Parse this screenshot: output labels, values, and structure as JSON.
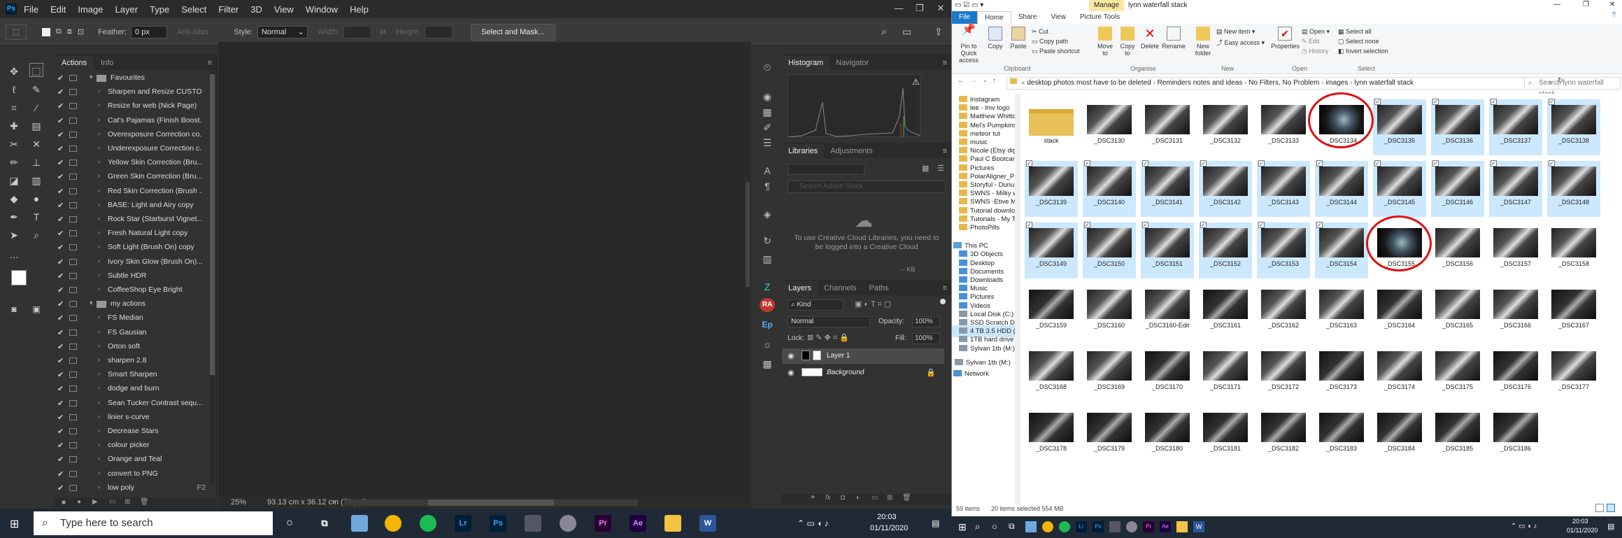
{
  "ps": {
    "logo": "Ps",
    "menu": [
      "File",
      "Edit",
      "Image",
      "Layer",
      "Type",
      "Select",
      "Filter",
      "3D",
      "View",
      "Window",
      "Help"
    ],
    "options": {
      "feather_label": "Feather:",
      "feather_value": "0 px",
      "antialias": "Anti-alias",
      "style_label": "Style:",
      "style_value": "Normal",
      "width_label": "Width:",
      "height_label": "Height:",
      "select_mask": "Select and Mask..."
    },
    "actions_tabs": [
      "Actions",
      "Info"
    ],
    "actions": [
      {
        "label": "Favourites",
        "type": "set",
        "check": "✔"
      },
      {
        "label": "Sharpen and Resize CUSTO...",
        "check": "✔"
      },
      {
        "label": "Resize for web (Nick Page)",
        "check": "✔"
      },
      {
        "label": "Cat's Pajamas (Finish Boost...",
        "check": "✔"
      },
      {
        "label": "Overexposure Correction co...",
        "check": "✔"
      },
      {
        "label": "Underexposure Correction c...",
        "check": "✔"
      },
      {
        "label": "Yellow Skin Correction (Bru...",
        "check": "✔"
      },
      {
        "label": "Green Skin Correction (Bru...",
        "check": "✔"
      },
      {
        "label": "Red Skin Correction (Brush ...",
        "check": "✔"
      },
      {
        "label": "BASE: Light and Airy copy",
        "check": "✔"
      },
      {
        "label": "Rock Star (Starburst Vignet...",
        "check": "✔"
      },
      {
        "label": "Fresh Natural Light copy",
        "check": "✔"
      },
      {
        "label": "Soft Light (Brush On) copy",
        "check": "✔"
      },
      {
        "label": "Ivory Skin Glow (Brush On)...",
        "check": "✔"
      },
      {
        "label": "Subtle HDR",
        "check": "✔"
      },
      {
        "label": "CoffeeShop Eye Bright",
        "check": "✔"
      },
      {
        "label": "my actions",
        "type": "set",
        "check": "✔"
      },
      {
        "label": "FS Median",
        "check": "✔"
      },
      {
        "label": "FS Gausian",
        "check": "✔"
      },
      {
        "label": "Orton soft",
        "check": "✔"
      },
      {
        "label": "sharpen 2.8",
        "check": "✔"
      },
      {
        "label": "Smart Sharpen",
        "check": "✔"
      },
      {
        "label": "dodge and burn",
        "check": "✔"
      },
      {
        "label": "Sean Tucker Contrast sequ...",
        "check": "✔"
      },
      {
        "label": "linier s-curve",
        "check": "✔"
      },
      {
        "label": "Decrease Stars",
        "check": "✔"
      },
      {
        "label": "colour picker",
        "check": "✔"
      },
      {
        "label": "Orange and Teal",
        "check": "✔"
      },
      {
        "label": "convert to PNG",
        "check": "✔"
      },
      {
        "label": "low poly",
        "check": "✔",
        "key": "F2"
      }
    ],
    "status": {
      "zoom": "25%",
      "size": "93.13 cm x 36.12 cm (72 ppi)"
    },
    "histogram_tabs": [
      "Histogram",
      "Navigator"
    ],
    "libraries_tabs": [
      "Libraries",
      "Adjustments"
    ],
    "libraries": {
      "search_placeholder": "Search Adobe Stock",
      "message": "To use Creative Cloud Libraries, you need to be logged into a Creative Cloud",
      "kb": "-- KB"
    },
    "layers_tabs": [
      "Layers",
      "Channels",
      "Paths"
    ],
    "layers": {
      "kind": "Kind",
      "blend": "Normal",
      "opacity_label": "Opacity:",
      "opacity": "100%",
      "lock_label": "Lock:",
      "fill_label": "Fill:",
      "fill": "100%",
      "items": [
        "Layer 1",
        "Background"
      ]
    },
    "strip_icons": [
      "RA",
      "Ep"
    ]
  },
  "taskbar": {
    "search_placeholder": "Type here to search",
    "time": "20:03",
    "date": "01/11/2020"
  },
  "explorer": {
    "title": "lynn waterfall stack",
    "manage": "Manage",
    "tabs": [
      "File",
      "Home",
      "Share",
      "View",
      "Picture Tools"
    ],
    "ribbon": {
      "pin": "Pin to Quick access",
      "copy": "Copy",
      "paste": "Paste",
      "cut": "Cut",
      "copy_path": "Copy path",
      "paste_shortcut": "Paste shortcut",
      "move_to": "Move to",
      "copy_to": "Copy to",
      "delete": "Delete",
      "rename": "Rename",
      "new_folder": "New folder",
      "new_item": "New item",
      "easy_access": "Easy access",
      "properties": "Properties",
      "open": "Open",
      "edit": "Edit",
      "history": "History",
      "select_all": "Select all",
      "select_none": "Select none",
      "invert": "Invert selection",
      "groups": [
        "Clipboard",
        "Organise",
        "New",
        "Open",
        "Select"
      ]
    },
    "path": [
      "desktop photos most have to be deleted",
      "Reminders notes and ideas",
      "No Filters, No Problem",
      "images",
      "lynn waterfall stack"
    ],
    "search_placeholder": "Search lynn waterfall stack",
    "nav": [
      "Instagram",
      "lee - lmv logo",
      "Matthew Whitto",
      "Mel's Pumpkins",
      "meteor tut",
      "music",
      "Nicole (Etsy digi",
      "Paul C Bootcam",
      "Pictures",
      "PolarAligner_Pro",
      "Storyful - Dunur",
      "SWNS - Milky wa",
      "SWNS -Etive Mo",
      "Tutorial downlo",
      "Tutorials - My T",
      "PhotoPills"
    ],
    "nav_pc": [
      "This PC",
      "3D Objects",
      "Desktop",
      "Documents",
      "Downloads",
      "Music",
      "Pictures",
      "Videos",
      "Local Disk (C:)",
      "SSD Scratch Disk",
      "4 TB 3.5 HDD (F:",
      "1TB hard drive (",
      "Sylvan 1tb (M:)"
    ],
    "nav_extra": [
      "Sylvan 1tb (M:)",
      "Network"
    ],
    "files": [
      "stack",
      "_DSC3130",
      "_DSC3131",
      "_DSC3132",
      "_DSC3133",
      "_DSC3134",
      "_DSC3135",
      "_DSC3136",
      "_DSC3137",
      "_DSC3138",
      "_DSC3139",
      "_DSC3140",
      "_DSC3141",
      "_DSC3142",
      "_DSC3143",
      "_DSC3144",
      "_DSC3145",
      "_DSC3146",
      "_DSC3147",
      "_DSC3148",
      "_DSC3149",
      "_DSC3150",
      "_DSC3151",
      "_DSC3152",
      "_DSC3153",
      "_DSC3154",
      "_DSC3155",
      "_DSC3156",
      "_DSC3157",
      "_DSC3158",
      "_DSC3159",
      "_DSC3160",
      "_DSC3160-Edit",
      "_DSC3161",
      "_DSC3162",
      "_DSC3163",
      "_DSC3164",
      "_DSC3165",
      "_DSC3166",
      "_DSC3167",
      "_DSC3168",
      "_DSC3169",
      "_DSC3170",
      "_DSC3171",
      "_DSC3172",
      "_DSC3173",
      "_DSC3174",
      "_DSC3175",
      "_DSC3176",
      "_DSC3177",
      "_DSC3178",
      "_DSC3179",
      "_DSC3180",
      "_DSC3181",
      "_DSC3182",
      "_DSC3183",
      "_DSC3184",
      "_DSC3185",
      "_DSC3186"
    ],
    "selected_count": 20,
    "status": {
      "items": "59 items",
      "selected": "20 items selected  554 MB"
    },
    "time": "20:03",
    "date": "01/11/2020"
  }
}
